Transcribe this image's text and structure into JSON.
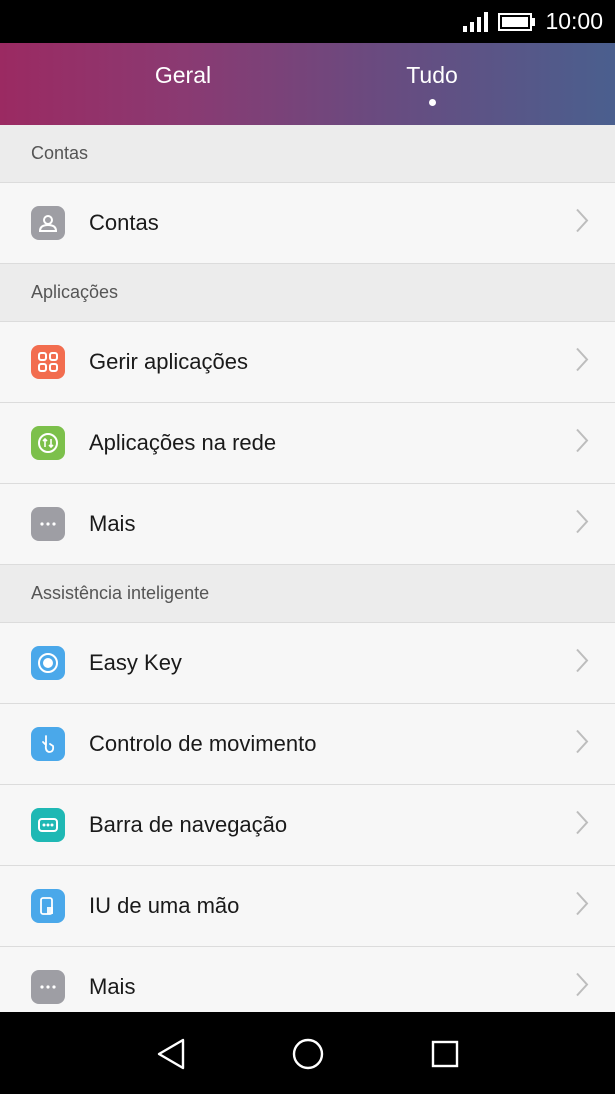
{
  "status_bar": {
    "time": "10:00",
    "signal_icon": "signal-icon",
    "battery_icon": "battery-icon"
  },
  "tabs": [
    {
      "label": "Geral",
      "active": false
    },
    {
      "label": "Tudo",
      "active": true
    }
  ],
  "sections": [
    {
      "header": "Contas",
      "items": [
        {
          "label": "Contas",
          "icon": "account-icon",
          "color": "#9e9ea4"
        }
      ]
    },
    {
      "header": "Aplicações",
      "items": [
        {
          "label": "Gerir aplicações",
          "icon": "apps-grid-icon",
          "color": "#f26d4f"
        },
        {
          "label": "Aplicações na rede",
          "icon": "network-apps-icon",
          "color": "#7cc04b"
        },
        {
          "label": "Mais",
          "icon": "more-icon",
          "color": "#9e9ea4"
        }
      ]
    },
    {
      "header": "Assistência inteligente",
      "items": [
        {
          "label": "Easy Key",
          "icon": "easy-key-icon",
          "color": "#4aa8ea"
        },
        {
          "label": "Controlo de movimento",
          "icon": "motion-control-icon",
          "color": "#4aa8ea"
        },
        {
          "label": "Barra de navegação",
          "icon": "navigation-bar-icon",
          "color": "#1fb8b4"
        },
        {
          "label": "IU de uma mão",
          "icon": "one-hand-ui-icon",
          "color": "#4aa8ea"
        },
        {
          "label": "Mais",
          "icon": "more-icon",
          "color": "#9e9ea4"
        }
      ]
    }
  ],
  "nav_bar": {
    "back_icon": "back-icon",
    "home_icon": "home-icon",
    "recents_icon": "recents-icon"
  }
}
